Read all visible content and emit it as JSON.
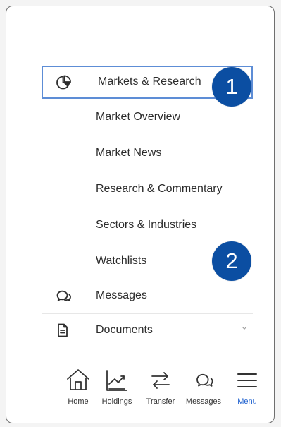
{
  "menu": {
    "top_item": {
      "label": "Markets & Research",
      "icon": "pie-chart-icon"
    },
    "subitems": [
      "Market Overview",
      "Market News",
      "Research & Commentary",
      "Sectors & Industries",
      "Watchlists"
    ],
    "other_items": [
      {
        "label": "Messages",
        "icon": "chat-icon"
      },
      {
        "label": "Documents",
        "icon": "document-icon"
      }
    ]
  },
  "badges": {
    "first": "1",
    "second": "2"
  },
  "bottom_nav": [
    {
      "label": "Home",
      "icon": "home-icon"
    },
    {
      "label": "Holdings",
      "icon": "holdings-icon"
    },
    {
      "label": "Transfer",
      "icon": "transfer-icon"
    },
    {
      "label": "Messages",
      "icon": "messages-icon"
    },
    {
      "label": "Menu",
      "icon": "menu-icon"
    }
  ],
  "colors": {
    "accent": "#0b4ea2",
    "focus_outline": "#5d8dd6",
    "active_nav": "#1c5fce",
    "text": "#2d2d2d"
  }
}
